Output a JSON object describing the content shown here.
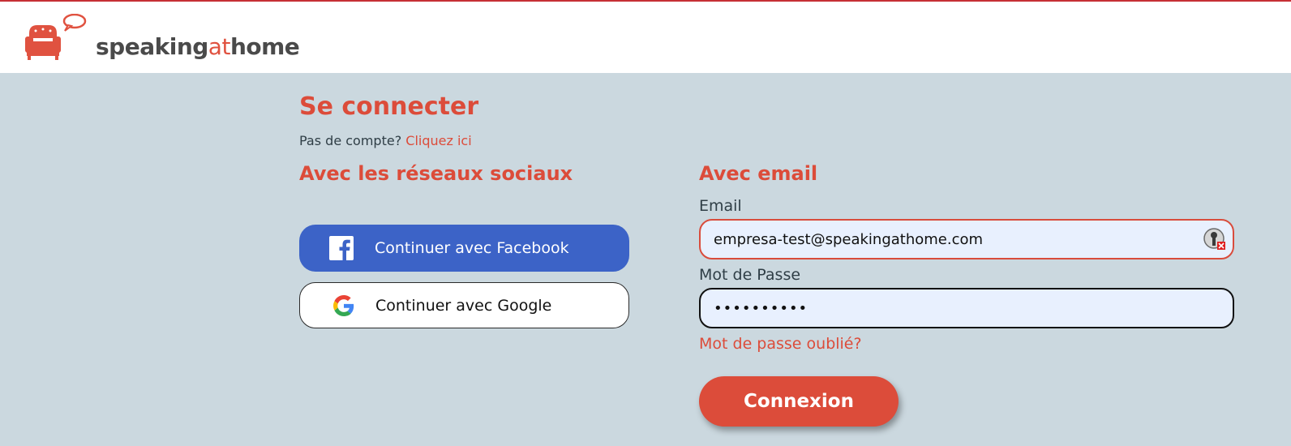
{
  "header": {
    "logo": {
      "text_main": "speaking",
      "text_at": "at",
      "text_end": "home",
      "icon": "armchair-chat-logo"
    }
  },
  "login": {
    "title": "Se connecter",
    "no_account_text": "Pas de compte?",
    "no_account_link": "Cliquez ici"
  },
  "social": {
    "title": "Avec les réseaux sociaux",
    "facebook_label": "Continuer avec Facebook",
    "facebook_icon": "facebook-icon",
    "google_label": "Continuer avec Google",
    "google_icon": "google-icon"
  },
  "email_section": {
    "title": "Avec email",
    "email_label": "Email",
    "email_value": "empresa-test@speakingathome.com",
    "password_label": "Mot de Passe",
    "password_value": "••••••••••",
    "forgot_link": "Mot de passe oublié?",
    "submit_label": "Connexion"
  },
  "colors": {
    "accent": "#dc4c3a",
    "background": "#cbd8df",
    "facebook": "#3c63c7",
    "input_bg": "#e8f0fe"
  }
}
